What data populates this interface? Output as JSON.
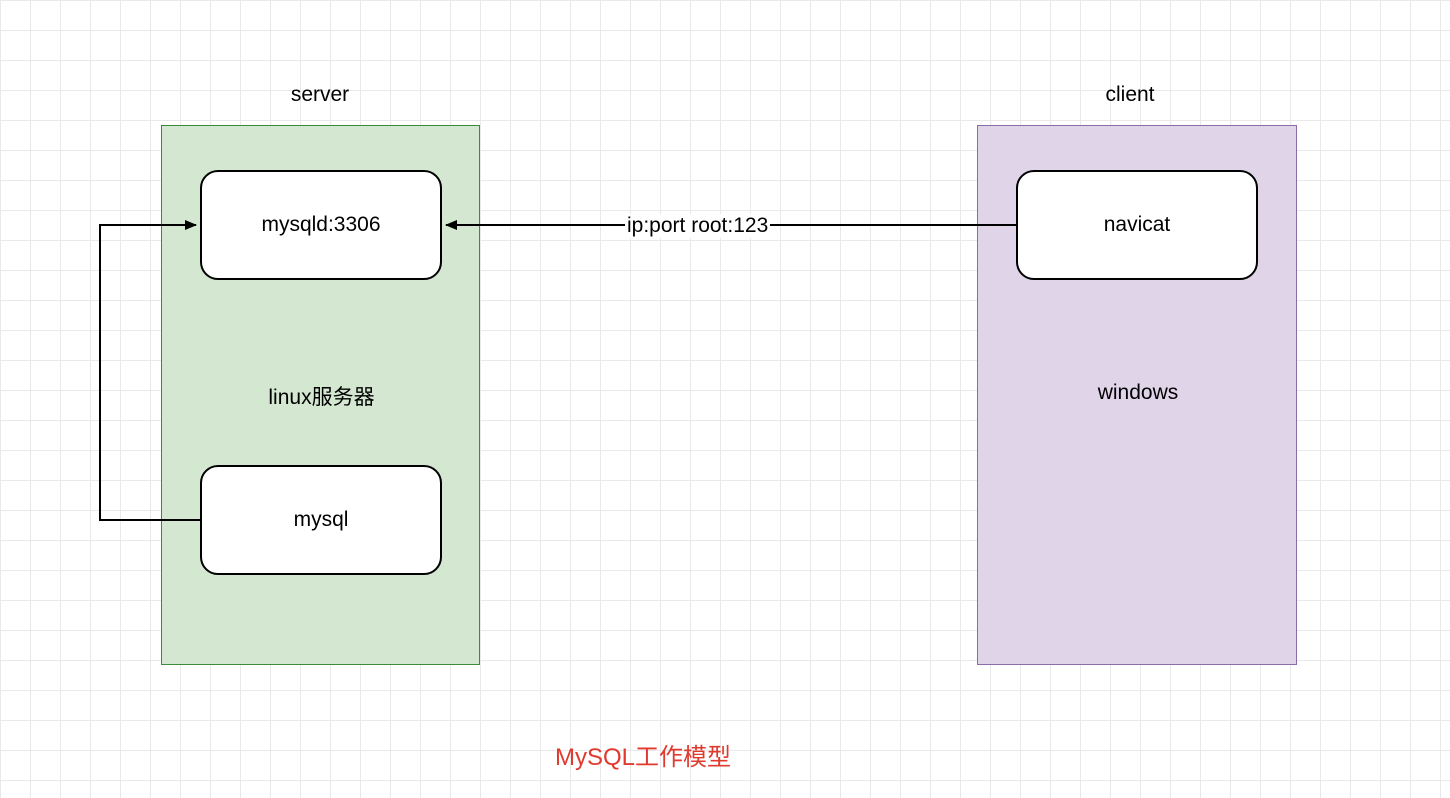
{
  "labels": {
    "server_title": "server",
    "client_title": "client",
    "server_container": "linux服务器",
    "client_container": "windows",
    "mysqld_node": "mysqld:3306",
    "mysql_node": "mysql",
    "navicat_node": "navicat",
    "connection_label": "ip:port root:123",
    "diagram_title": "MySQL工作模型"
  },
  "colors": {
    "grid_line": "#e9e9e9",
    "server_fill": "#d4e8d1",
    "server_border": "#3c8a3c",
    "client_fill": "#e0d5e8",
    "client_border": "#8a6ca8",
    "node_border": "#000000",
    "title_red": "#e03a2f"
  }
}
